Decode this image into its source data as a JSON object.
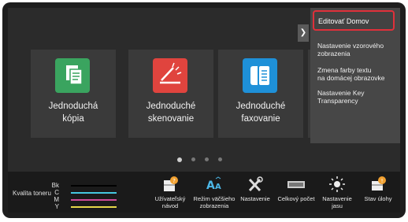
{
  "home_tiles": [
    {
      "label": "Jednoduchá\nkópia",
      "icon": "copy-icon",
      "color": "#3aa45f"
    },
    {
      "label": "Jednoduché\nskenovanie",
      "icon": "scanner-icon",
      "color": "#e0443e"
    },
    {
      "label": "Jednoduché\nfaxovanie",
      "icon": "fax-icon",
      "color": "#1e90d8"
    }
  ],
  "page_dots": {
    "count": 4,
    "active_index": 0
  },
  "toner": {
    "title": "Kvalita toneru",
    "rows": [
      {
        "key": "Bk",
        "color": "#000000"
      },
      {
        "key": "C",
        "color": "#45c8e0"
      },
      {
        "key": "M",
        "color": "#d04a9a"
      },
      {
        "key": "Y",
        "color": "#e8d84a"
      }
    ]
  },
  "quick_actions": [
    {
      "label": "Užívateľský\nnávod",
      "icon": "user-manual-icon"
    },
    {
      "label": "Režim väčšieho\nzobrazenia",
      "icon": "large-text-icon"
    },
    {
      "label": "Nastavenie",
      "icon": "settings-tools-icon"
    },
    {
      "label": "Celkový počet",
      "icon": "counter-icon"
    },
    {
      "label": "Nastavenie\njasu",
      "icon": "brightness-icon"
    },
    {
      "label": "Stav úlohy",
      "icon": "job-status-icon"
    }
  ],
  "menu": {
    "expand_icon": "chevron-right-icon",
    "items": [
      "Editovať Domov",
      "Nastavenie vzorového\nzobrazenia",
      "Zmena farby textu\nna domácej obrazovke",
      "Nastavenie Key\nTransparency"
    ],
    "highlight_color": "#e0303a"
  }
}
